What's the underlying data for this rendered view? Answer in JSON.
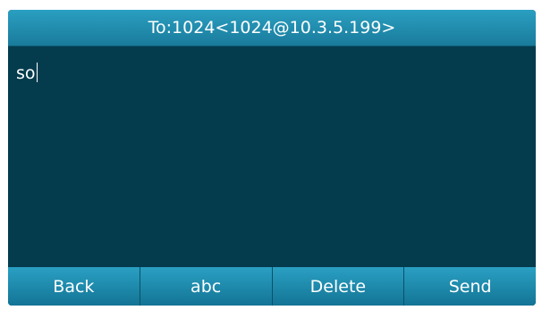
{
  "header": {
    "title": "To:1024<1024@10.3.5.199>"
  },
  "message": {
    "text": "so"
  },
  "softkeys": [
    {
      "label": "Back"
    },
    {
      "label": "abc"
    },
    {
      "label": "Delete"
    },
    {
      "label": "Send"
    }
  ],
  "colors": {
    "background": "#043c4d",
    "accent": "#1f8db0",
    "text": "#ffffff"
  }
}
